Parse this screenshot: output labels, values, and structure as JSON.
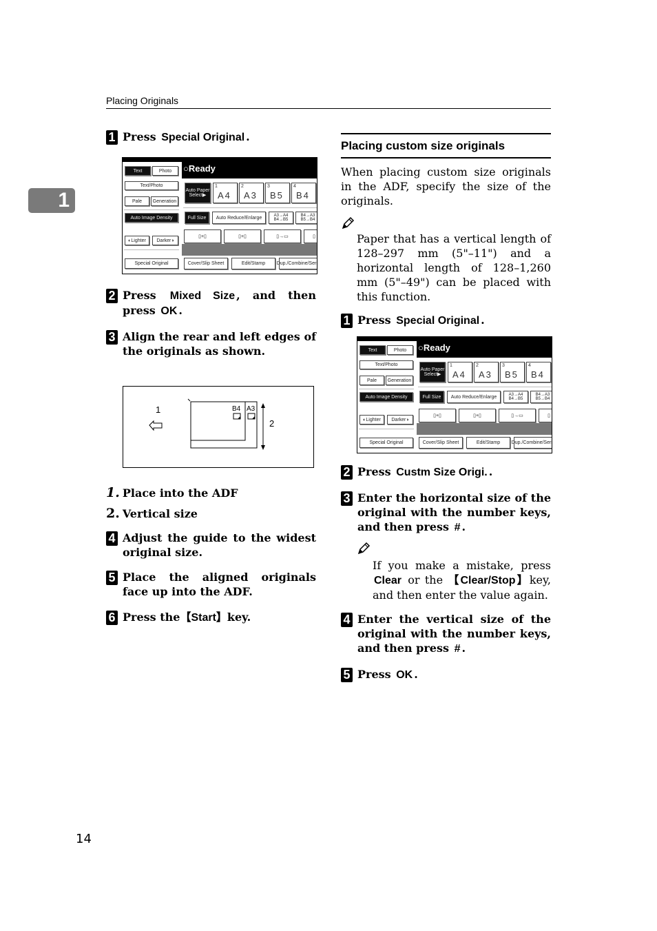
{
  "header": {
    "title": "Placing Originals"
  },
  "chapter_tab": "1",
  "page_number": "14",
  "left": {
    "step1": {
      "num": "1",
      "pre": "Press",
      "key": "Special Original",
      "post": "."
    },
    "step2": {
      "num": "2",
      "pre": "Press",
      "key1": "Mixed Size",
      "mid": ", and then press",
      "key2": "OK",
      "post": "."
    },
    "step3": {
      "num": "3",
      "text": "Align the rear and left edges of the originals as shown."
    },
    "figure": {
      "label1": "1",
      "label2": "2",
      "size_b4": "B4",
      "size_a3": "A3"
    },
    "legend": [
      {
        "n": "1.",
        "text": "Place into the ADF"
      },
      {
        "n": "2.",
        "text": "Vertical size"
      }
    ],
    "step4": {
      "num": "4",
      "text": "Adjust the guide to the widest original size."
    },
    "step5": {
      "num": "5",
      "text": "Place the aligned originals face up into the ADF."
    },
    "step6": {
      "num": "6",
      "pre": "Press the",
      "key": "【Start】",
      "post": "key."
    }
  },
  "panel": {
    "status": "○Ready",
    "left_buttons": [
      "Text",
      "Photo",
      "Text/Photo",
      "Pale",
      "Generation",
      "Auto Image Density",
      "◐Lighter",
      "Darker◑",
      "Special Original"
    ],
    "paper_select": "Auto Paper Select▶",
    "trays": [
      {
        "tray": "1",
        "size": "A4"
      },
      {
        "tray": "2",
        "size": "A3"
      },
      {
        "tray": "3",
        "size": "B5"
      },
      {
        "tray": "4",
        "size": "B4"
      }
    ],
    "ratio_buttons": [
      "Full Size",
      "Auto Reduce/Enlarge",
      "A3→A4 B4→B5",
      "B4→A3 B5→B4"
    ],
    "bottom_buttons": [
      "Cover/Slip Sheet",
      "Edit/Stamp",
      "Dup./Combine/Series"
    ]
  },
  "right": {
    "section_title": "Placing custom size originals",
    "intro": "When placing custom size originals in the ADF, specify the size of the originals.",
    "note1": "Paper that has a vertical length of 128–297 mm (5\"–11\") and a horizontal length of 128–1,260 mm (5\"–49\") can be placed with this function.",
    "step1": {
      "num": "1",
      "pre": "Press",
      "key": "Special Original",
      "post": "."
    },
    "step2": {
      "num": "2",
      "pre": "Press",
      "key": "Custm Size Origi.",
      "post": "."
    },
    "step3": {
      "num": "3",
      "pre": "Enter the horizontal size of the original with the number keys, and then press",
      "key": "#",
      "post": "."
    },
    "note2": {
      "pre": "If you make a mistake, press",
      "key1": "Clear",
      "mid": "or the",
      "key2": "【Clear/Stop】",
      "post": "key, and then enter the value again."
    },
    "step4": {
      "num": "4",
      "pre": "Enter the vertical size of the original with the number keys, and then press",
      "key": "#",
      "post": "."
    },
    "step5": {
      "num": "5",
      "pre": "Press",
      "key": "OK",
      "post": "."
    }
  }
}
